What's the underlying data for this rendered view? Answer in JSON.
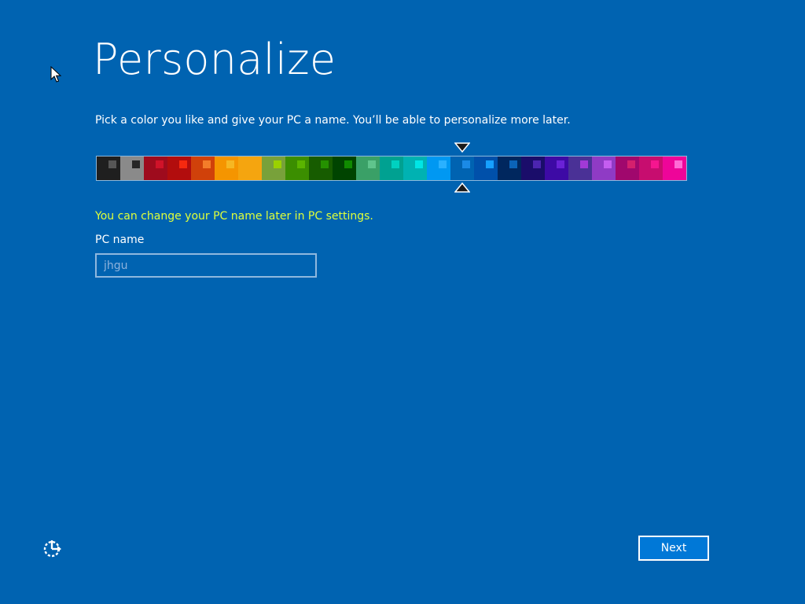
{
  "title": "Personalize",
  "subtitle": "Pick a color you like and give your PC a name. You’ll be able to personalize more later.",
  "palette": {
    "selected_index": 15,
    "swatches": [
      {
        "bg": "#1f1f1f",
        "accent": "#565656"
      },
      {
        "bg": "#8a8a8a",
        "accent": "#262626"
      },
      {
        "bg": "#9e0b1d",
        "accent": "#d01329"
      },
      {
        "bg": "#b20d0d",
        "accent": "#f5290f"
      },
      {
        "bg": "#d0410a",
        "accent": "#f37d2a"
      },
      {
        "bg": "#f59500",
        "accent": "#f6b723"
      },
      {
        "bg": "#f5a50f",
        "accent": "#f5a50f"
      },
      {
        "bg": "#78a13a",
        "accent": "#9ad100"
      },
      {
        "bg": "#3b8e00",
        "accent": "#5ab400"
      },
      {
        "bg": "#175c00",
        "accent": "#259100"
      },
      {
        "bg": "#004400",
        "accent": "#108a00"
      },
      {
        "bg": "#3aa067",
        "accent": "#5fc48c"
      },
      {
        "bg": "#00a191",
        "accent": "#00d1c0"
      },
      {
        "bg": "#00b2b2",
        "accent": "#00e5e5"
      },
      {
        "bg": "#0098f2",
        "accent": "#2ab1ff"
      },
      {
        "bg": "#0063b1",
        "accent": "#1b8ae6"
      },
      {
        "bg": "#0050aa",
        "accent": "#16a0ff"
      },
      {
        "bg": "#00275e",
        "accent": "#0b63b8"
      },
      {
        "bg": "#1a0d6a",
        "accent": "#4b25b0"
      },
      {
        "bg": "#3d0aa5",
        "accent": "#6a22d6"
      },
      {
        "bg": "#4a3196",
        "accent": "#a13ad7"
      },
      {
        "bg": "#8f3bc5",
        "accent": "#c45ef0"
      },
      {
        "bg": "#a0086d",
        "accent": "#d4206d"
      },
      {
        "bg": "#c70d6f",
        "accent": "#f5168f"
      },
      {
        "bg": "#ee0599",
        "accent": "#ff6ad5"
      }
    ]
  },
  "notice": "You can change your PC name later in PC settings.",
  "notice_color": "#dfff3a",
  "pc_name": {
    "label": "PC name",
    "value": "jhgu"
  },
  "next_button": {
    "label": "Next"
  },
  "colors": {
    "background": "#0063b1",
    "input_text": "#8fb3dc",
    "button_bg": "#0078d7"
  },
  "icons": {
    "cursor": "arrow-cursor-icon",
    "ease_of_access": "ease-of-access-icon",
    "marker": "triangle-marker-icon"
  }
}
